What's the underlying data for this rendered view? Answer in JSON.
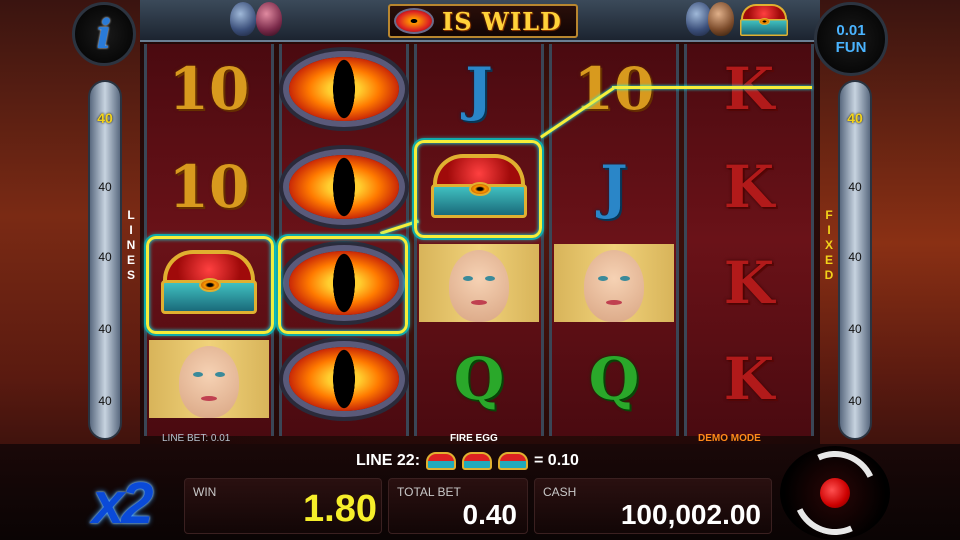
{
  "header": {
    "title": "IS WILD",
    "info_label": "i",
    "bet_value": "0.01",
    "currency_label": "FUN"
  },
  "lines_left": {
    "top": "40",
    "items": [
      "40",
      "40",
      "40",
      "40",
      "40"
    ],
    "label": [
      "L",
      "I",
      "N",
      "E",
      "S"
    ]
  },
  "lines_right": {
    "top": "40",
    "items": [
      "40",
      "40",
      "40",
      "40",
      "40"
    ],
    "label": [
      "F",
      "I",
      "X",
      "E",
      "D"
    ]
  },
  "reels": [
    [
      "10",
      "10",
      "chest",
      "princess"
    ],
    [
      "dragon-eye",
      "dragon-eye",
      "dragon-eye",
      "dragon-eye"
    ],
    [
      "J",
      "chest",
      "princess",
      "Q"
    ],
    [
      "10",
      "J",
      "princess",
      "Q"
    ],
    [
      "K",
      "K",
      "K",
      "K"
    ]
  ],
  "captions": {
    "line_bet": "LINE BET: 0.01",
    "fire_egg": "FIRE EGG",
    "demo_mode": "DEMO MODE"
  },
  "line_win": {
    "line_label": "LINE 22:",
    "amount": "= 0.10",
    "symbol_count": 3
  },
  "multiplier": "x2",
  "bottom": {
    "win_label": "WIN",
    "win_value": "1.80",
    "total_bet_label": "TOTAL BET",
    "total_bet_value": "0.40",
    "cash_label": "CASH",
    "cash_value": "100,002.00"
  },
  "colors": {
    "highlight": "#f6ee3a",
    "fun_text": "#4ab4ff",
    "demo_mode": "#ff8a1a",
    "win_value": "#f6ee2a"
  }
}
